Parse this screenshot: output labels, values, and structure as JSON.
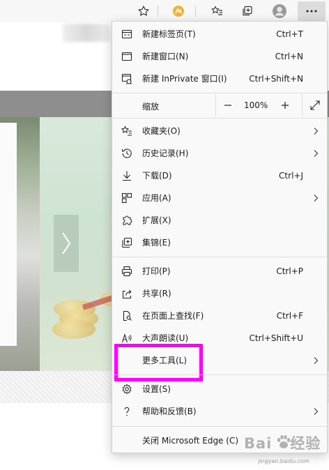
{
  "toolbar": {
    "icons": [
      "favorite-star-icon",
      "extension-icon",
      "favorites-list-icon",
      "collections-icon",
      "profile-avatar-icon",
      "more-ellipsis-icon"
    ]
  },
  "menu": {
    "items": [
      {
        "label": "新建标签页(T)",
        "shortcut": "Ctrl+T",
        "icon": "new-tab-icon"
      },
      {
        "label": "新建窗口(N)",
        "shortcut": "Ctrl+N",
        "icon": "new-window-icon"
      },
      {
        "label": "新建 InPrivate 窗口(I)",
        "shortcut": "Ctrl+Shift+N",
        "icon": "inprivate-window-icon"
      },
      {
        "label": "收藏夹(O)",
        "shortcut": "",
        "icon": "favorites-icon"
      },
      {
        "label": "历史记录(H)",
        "shortcut": "",
        "icon": "history-icon"
      },
      {
        "label": "下载(D)",
        "shortcut": "Ctrl+J",
        "icon": "download-icon"
      },
      {
        "label": "应用(A)",
        "shortcut": "",
        "icon": "apps-icon"
      },
      {
        "label": "扩展(X)",
        "shortcut": "",
        "icon": "extensions-puzzle-icon"
      },
      {
        "label": "集锦(E)",
        "shortcut": "",
        "icon": "collections-icon"
      },
      {
        "label": "打印(P)",
        "shortcut": "Ctrl+P",
        "icon": "print-icon"
      },
      {
        "label": "共享(R)",
        "shortcut": "",
        "icon": "share-icon"
      },
      {
        "label": "在页面上查找(F)",
        "shortcut": "Ctrl+F",
        "icon": "find-on-page-icon"
      },
      {
        "label": "大声朗读(U)",
        "shortcut": "Ctrl+Shift+U",
        "icon": "read-aloud-icon"
      },
      {
        "label": "更多工具(L)",
        "shortcut": "",
        "icon": "more-tools-icon"
      },
      {
        "label": "设置(S)",
        "shortcut": "",
        "icon": "settings-gear-icon"
      },
      {
        "label": "帮助和反馈(B)",
        "shortcut": "",
        "icon": "help-question-icon"
      },
      {
        "label": "关闭 Microsoft Edge (C)",
        "shortcut": "",
        "icon": ""
      }
    ],
    "zoom": {
      "label": "缩放",
      "value": "100%",
      "minus": "—",
      "plus": "+"
    }
  },
  "highlight_color": "#ff00ff",
  "watermark": {
    "brand": "Bai",
    "brand2": "经验",
    "sub": "jingyan.baidu.com"
  }
}
